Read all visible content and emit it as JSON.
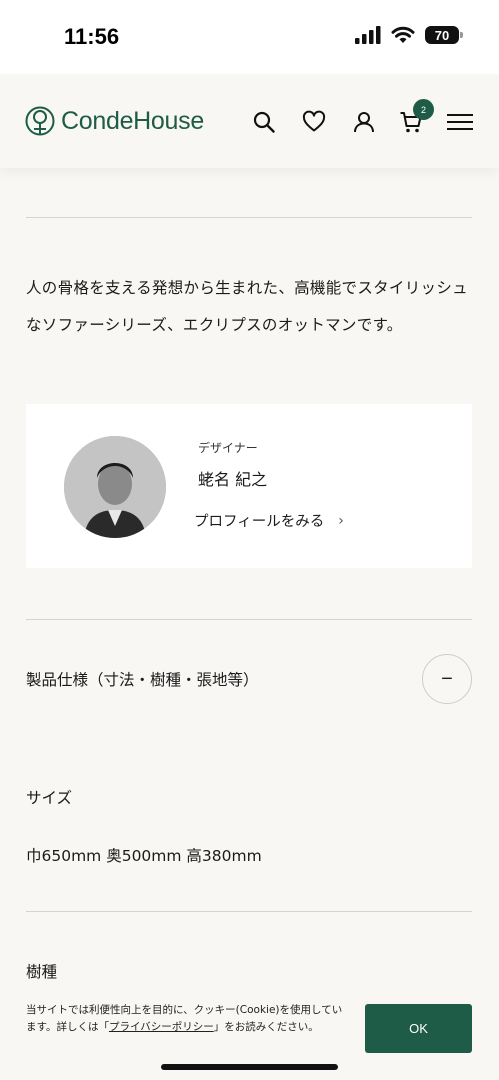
{
  "status_bar": {
    "time": "11:56",
    "battery": "70"
  },
  "header": {
    "logo_text": "CondeHouse",
    "cart_count": "2"
  },
  "product": {
    "description": "人の骨格を支える発想から生まれた、高機能でスタイリッシュなソファーシリーズ、エクリプスのオットマンです。"
  },
  "designer": {
    "role": "デザイナー",
    "name": "蛯名 紀之",
    "profile_link": "プロフィールをみる",
    "chevron": "›"
  },
  "specs": {
    "title": "製品仕様（寸法・樹種・張地等）",
    "toggle": "−",
    "size_label": "サイズ",
    "size_value": "巾650mm 奥500mm 高380mm",
    "wood_label": "樹種"
  },
  "cookie": {
    "text_before": "当サイトでは利便性向上を目的に、クッキー(Cookie)を使用しています。詳しくは「",
    "link": "プライバシーポリシー",
    "text_after": "」をお読みください。",
    "ok_label": "OK"
  },
  "colors": {
    "brand": "#1f5c47",
    "background": "#f8f7f4"
  }
}
